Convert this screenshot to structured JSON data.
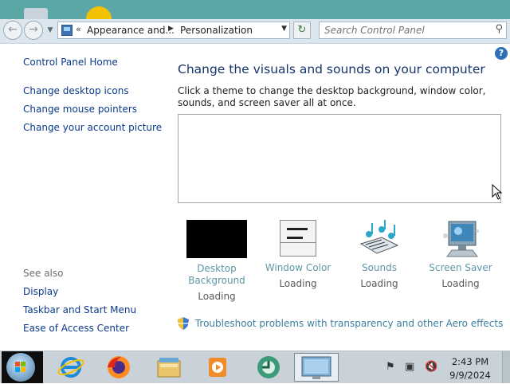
{
  "address_bar": {
    "breadcrumb": [
      "Appearance and...",
      "Personalization"
    ],
    "search_placeholder": "Search Control Panel"
  },
  "left_nav": {
    "home": "Control Panel Home",
    "links": [
      "Change desktop icons",
      "Change mouse pointers",
      "Change your account picture"
    ],
    "see_also_label": "See also",
    "see_also": [
      "Display",
      "Taskbar and Start Menu",
      "Ease of Access Center"
    ]
  },
  "main": {
    "heading": "Change the visuals and sounds on your computer",
    "description": "Click a theme to change the desktop background, window color, sounds, and screen saver all at once.",
    "items": [
      {
        "label_line1": "Desktop",
        "label_line2": "Background",
        "status": "Loading",
        "icon": "desktop-background-thumbnail"
      },
      {
        "label_line1": "Window Color",
        "status": "Loading",
        "icon": "window-color-icon"
      },
      {
        "label_line1": "Sounds",
        "status": "Loading",
        "icon": "sounds-icon"
      },
      {
        "label_line1": "Screen Saver",
        "status": "Loading",
        "icon": "screen-saver-icon"
      }
    ],
    "troubleshoot": "Troubleshoot problems with transparency and other Aero effects"
  },
  "taskbar": {
    "time": "2:43 PM",
    "date": "9/9/2024",
    "apps": [
      "internet-explorer-icon",
      "firefox-icon",
      "file-explorer-icon",
      "media-player-icon",
      "control-panel-icon",
      "personalization-icon"
    ]
  },
  "colors": {
    "link": "#0b3a8a",
    "heading": "#16336b",
    "muted_link": "#5f97a9",
    "address_bg": "#dce6ee",
    "taskbar_bg": "#c9d2d8"
  }
}
